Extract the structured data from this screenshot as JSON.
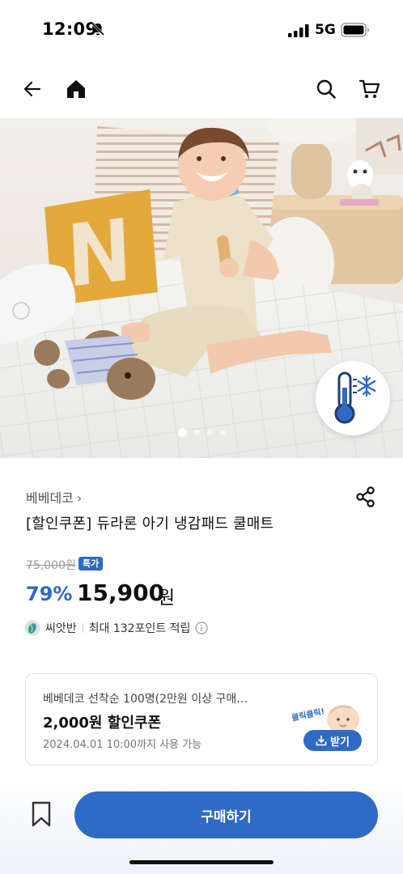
{
  "status_bar": {
    "time": "12:09",
    "network": "5G",
    "icons": [
      "bell-off-icon",
      "signal-icon",
      "battery-icon"
    ]
  },
  "nav": {
    "icons": [
      "back-arrow-icon",
      "home-icon",
      "search-icon",
      "cart-icon"
    ]
  },
  "product_image": {
    "carousel_total": 4,
    "carousel_current": 1,
    "badge_icon": "thermometer-snowflake-icon"
  },
  "product": {
    "brand": "베베데코",
    "brand_chevron": "›",
    "title": "[할인쿠폰] 듀라론 아기 냉감패드 쿨매트",
    "original_price": "75,000원",
    "special_badge": "특가",
    "discount_rate": "79%",
    "sale_price": "15,900",
    "currency": "원",
    "seed_label": "씨앗반",
    "points_text": "최대 132포인트 적립"
  },
  "coupon": {
    "description": "베베데코 선착순 100명(2만원 이상 구매…",
    "title": "2,000원 할인쿠폰",
    "expiry": "2024.04.01 10:00까지 사용 가능",
    "deco_text": "클릭클릭!",
    "download_label": "받기"
  },
  "bottom": {
    "buy_label": "구매하기"
  },
  "colors": {
    "accent": "#2f6ac6",
    "text": "#111111",
    "muted": "#999999"
  }
}
